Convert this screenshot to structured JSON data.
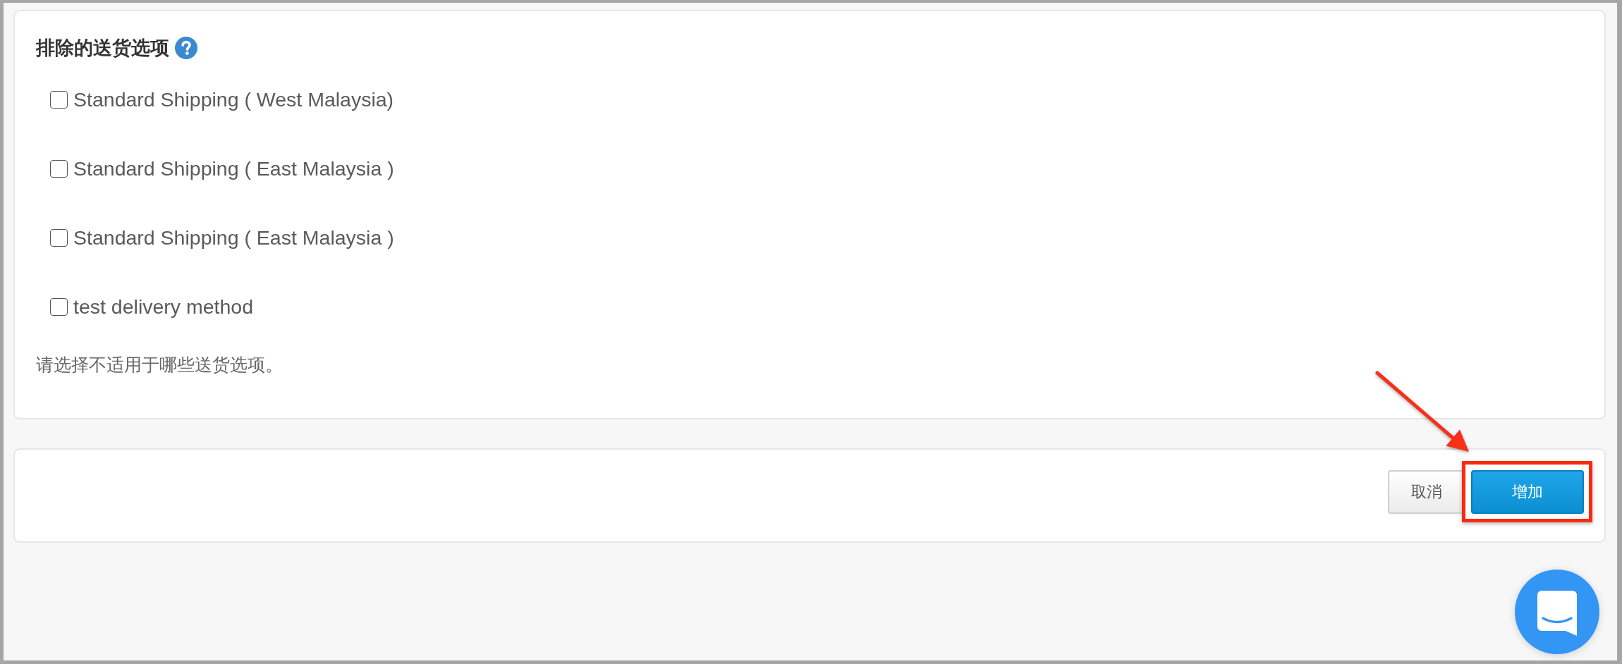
{
  "section": {
    "title": "排除的送货选项",
    "options": [
      {
        "label": "Standard Shipping ( West Malaysia)",
        "checked": false
      },
      {
        "label": "Standard Shipping ( East Malaysia )",
        "checked": false
      },
      {
        "label": "Standard Shipping ( East Malaysia )",
        "checked": false
      },
      {
        "label": "test delivery method",
        "checked": false
      }
    ],
    "hint": "请选择不适用于哪些送货选项。"
  },
  "actions": {
    "buttons": [
      {
        "label": "取消",
        "kind": "secondary",
        "highlighted": false
      },
      {
        "label": "增加",
        "kind": "primary",
        "highlighted": true
      }
    ]
  }
}
